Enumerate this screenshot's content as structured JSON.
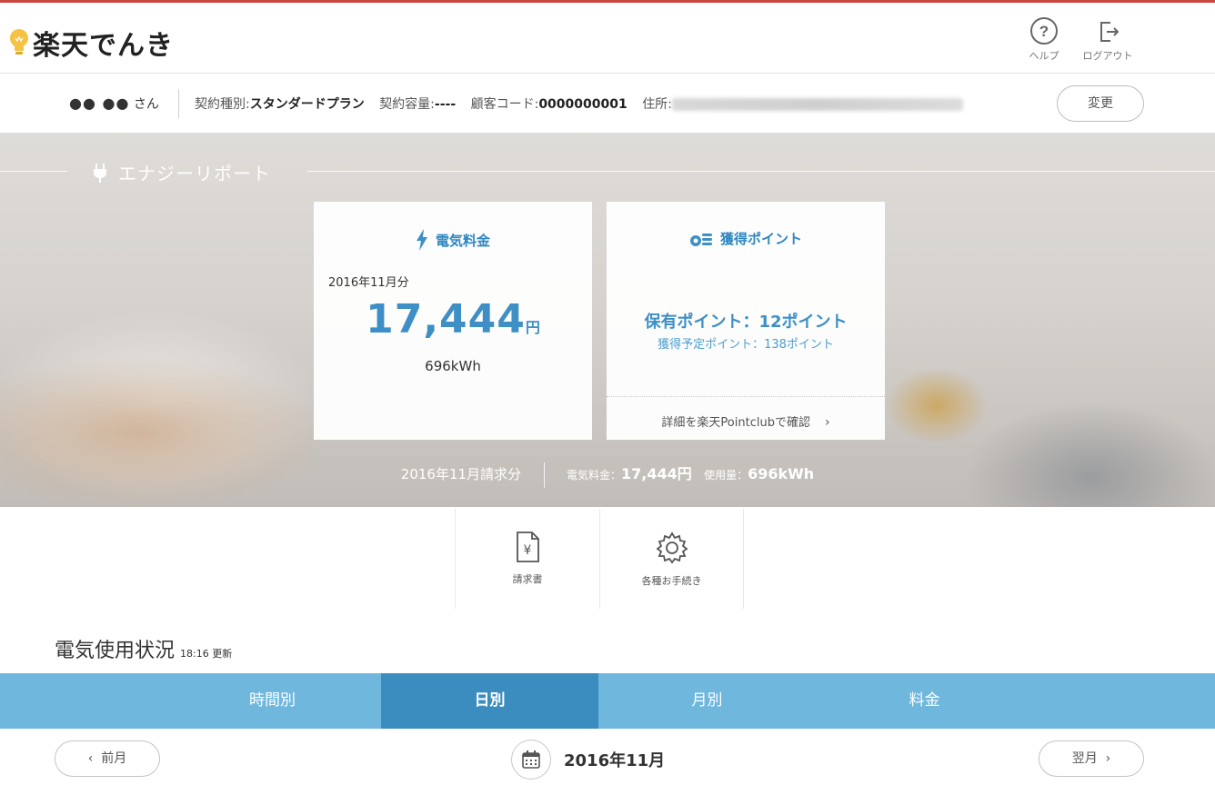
{
  "header": {
    "logo_text": "楽天でんき",
    "help_label": "ヘルプ",
    "logout_label": "ログアウト"
  },
  "account": {
    "name": "●● ●●",
    "name_suffix": "さん",
    "contract_type_label": "契約種別:",
    "contract_type_value": "スタンダードプラン",
    "capacity_label": "契約容量:",
    "capacity_value": "----",
    "customer_code_label": "顧客コード:",
    "customer_code_value": "0000000001",
    "address_label": "住所:",
    "change_button": "変更"
  },
  "hero": {
    "section_title": "エナジーリポート",
    "bill_card": {
      "title": "電気料金",
      "month": "2016年11月分",
      "amount": "17,444",
      "currency": "円",
      "usage": "696kWh"
    },
    "point_card": {
      "title": "獲得ポイント",
      "held": "保有ポイント：12ポイント",
      "planned": "獲得予定ポイント：138ポイント",
      "link": "詳細を楽天Pointclubで確認"
    },
    "summary": {
      "period": "2016年11月請求分",
      "fee_label": "電気料金：",
      "fee_value": "17,444円",
      "usage_label": "使用量：",
      "usage_value": "696kWh"
    }
  },
  "quick_menu": [
    {
      "label": "請求書",
      "icon": "invoice-icon"
    },
    {
      "label": "各種お手続き",
      "icon": "gear-icon"
    }
  ],
  "usage": {
    "title": "電気使用状況",
    "updated": "18:16 更新",
    "tabs": [
      "時間別",
      "日別",
      "月別",
      "料金"
    ],
    "active_tab": "日別",
    "prev_label": "前月",
    "next_label": "翌月",
    "current_month": "2016年11月"
  },
  "colors": {
    "accent": "#3d8fc6",
    "tab_bar": "#6fb7dd",
    "tab_active": "#3b8cbf",
    "brand_line": "#c9473f"
  }
}
